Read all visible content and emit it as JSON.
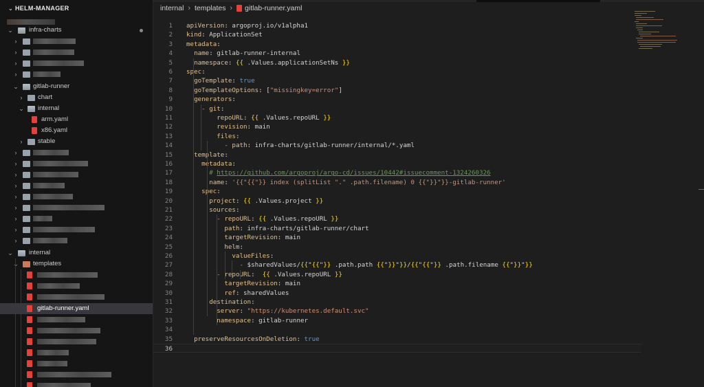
{
  "explorer": {
    "title": "HELM-MANAGER",
    "items": [
      {
        "label": "infra-charts",
        "kind": "folder",
        "expanded": true
      },
      {
        "label": "gitlab-runner",
        "kind": "folder",
        "expanded": true
      },
      {
        "label": "chart",
        "kind": "folder",
        "expanded": false
      },
      {
        "label": "internal",
        "kind": "folder",
        "expanded": true
      },
      {
        "label": "arm.yaml",
        "kind": "yaml-file"
      },
      {
        "label": "x86.yaml",
        "kind": "yaml-file"
      },
      {
        "label": "stable",
        "kind": "folder",
        "expanded": false
      },
      {
        "label": "internal",
        "kind": "folder",
        "expanded": true
      },
      {
        "label": "templates",
        "kind": "folder",
        "expanded": true
      },
      {
        "label": "gitlab-runner.yaml",
        "kind": "yaml-file",
        "selected": true
      }
    ]
  },
  "breadcrumb": {
    "parts": [
      "internal",
      "templates",
      "gitlab-runner.yaml"
    ]
  },
  "editor": {
    "active_line": 36,
    "line_numbers": [
      "1",
      "2",
      "3",
      "4",
      "5",
      "6",
      "7",
      "8",
      "9",
      "10",
      "11",
      "12",
      "13",
      "14",
      "15",
      "16",
      "17",
      "18",
      "19",
      "20",
      "21",
      "22",
      "23",
      "24",
      "25",
      "26",
      "27",
      "28",
      "29",
      "30",
      "31",
      "32",
      "33",
      "34",
      "35",
      "36"
    ],
    "lines": [
      "apiVersion: argoproj.io/v1alpha1",
      "kind: ApplicationSet",
      "metadata:",
      "  name: gitlab-runner-internal",
      "  namespace: {{ .Values.applicationSetNs }}",
      "spec:",
      "  goTemplate: true",
      "  goTemplateOptions: [\"missingkey=error\"]",
      "  generators:",
      "    - git:",
      "        repoURL: {{ .Values.repoURL }}",
      "        revision: main",
      "        files:",
      "          - path: infra-charts/gitlab-runner/internal/*.yaml",
      "  template:",
      "    metadata:",
      "      # https://github.com/argoproj/argo-cd/issues/10442#issuecomment-1324260326",
      "      name: '{{\"{{\"}} index (splitList \".\" .path.filename) 0 {{\"}}\"}}-gitlab-runner'",
      "    spec:",
      "      project: {{ .Values.project }}",
      "      sources:",
      "        - repoURL: {{ .Values.repoURL }}",
      "          path: infra-charts/gitlab-runner/chart",
      "          targetRevision: main",
      "          helm:",
      "            valueFiles:",
      "              - $sharedValues/{{\"{{\"}} .path.path {{\"}}\"}}/{{\"{{\"}} .path.filename {{\"}}\"}}",
      "        - repoURL:  {{ .Values.repoURL }}",
      "          targetRevision: main",
      "          ref: sharedValues",
      "      destination:",
      "        server: \"https://kubernetes.default.svc\"",
      "        namespace: gitlab-runner",
      "",
      "  preserveResourcesOnDeletion: true",
      ""
    ]
  },
  "colors": {
    "key": "#e2c08d",
    "string": "#ce9178",
    "boolean": "#569cd6",
    "comment": "#6a9955",
    "template": "#ffd700",
    "yaml_icon": "#e2423b",
    "selection": "#37373d"
  }
}
